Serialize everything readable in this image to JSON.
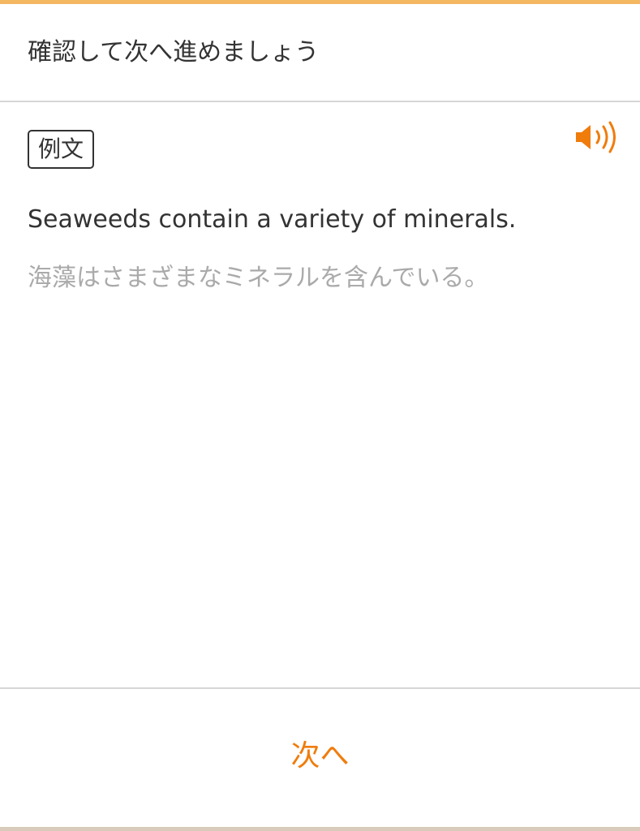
{
  "header": {
    "title": "確認して次へ進めましょう"
  },
  "example": {
    "tag_label": "例文",
    "sentence_en": "Seaweeds contain a variety of minerals.",
    "sentence_ja": "海藻はさまざまなミネラルを含んでいる。",
    "audio_icon": "speaker-icon"
  },
  "footer": {
    "next_label": "次へ"
  },
  "colors": {
    "accent": "#f07c0c",
    "text": "#333333",
    "muted_text": "#aaaaaa",
    "divider": "#d6d6d6"
  }
}
